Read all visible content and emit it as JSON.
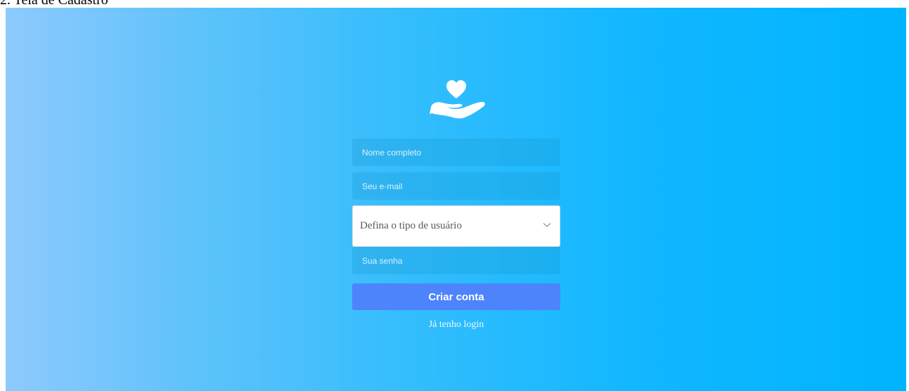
{
  "caption": "2. Tela de Cadastro",
  "logo": {
    "icon": "heart-hand-icon"
  },
  "form": {
    "name_placeholder": "Nome completo",
    "email_placeholder": "Seu e-mail",
    "user_type_selected": "Defina o tipo de usuário",
    "password_placeholder": "Sua senha",
    "submit_label": "Criar conta",
    "login_link": "Já tenho login"
  },
  "colors": {
    "gradient_start": "#8ecafc",
    "gradient_end": "#00b4ff",
    "button": "#4d84fb"
  }
}
